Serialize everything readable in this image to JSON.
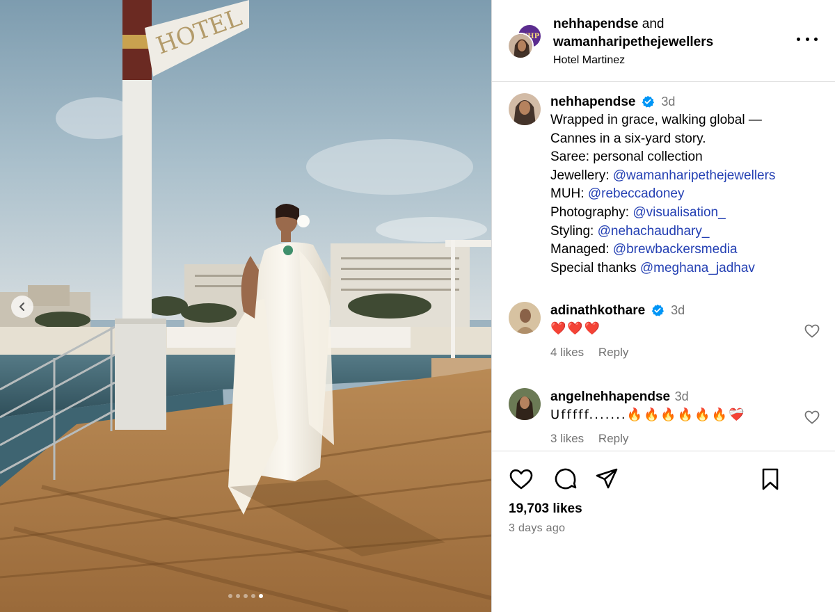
{
  "photo": {
    "sign_text": "HOTEL",
    "carousel_dots": 5,
    "active_dot": 5
  },
  "header": {
    "author": "nehhapendse",
    "and_text": " and",
    "collaborator": "wamanharipethejewellers",
    "location": "Hotel Martinez",
    "logo_text": "WHP"
  },
  "caption": {
    "username": "nehhapendse",
    "time": "3d",
    "lines": [
      {
        "text": "Wrapped in grace, walking global —",
        "mention": ""
      },
      {
        "text": "Cannes in a six-yard story.",
        "mention": ""
      },
      {
        "text": "Saree: personal collection",
        "mention": ""
      },
      {
        "text": "Jewellery: ",
        "mention": "@wamanharipethejewellers"
      },
      {
        "text": "MUH: ",
        "mention": "@rebeccadoney"
      },
      {
        "text": "Photography: ",
        "mention": "@visualisation_"
      },
      {
        "text": "Styling: ",
        "mention": "@nehachaudhary_"
      },
      {
        "text": "Managed: ",
        "mention": "@brewbackersmedia"
      },
      {
        "text": "Special thanks ",
        "mention": "@meghana_jadhav"
      }
    ]
  },
  "comments": [
    {
      "username": "adinathkothare",
      "time": "3d",
      "text": "❤️❤️❤️",
      "likes": "4 likes",
      "reply": "Reply"
    },
    {
      "username": "angelnehhapendse",
      "time": "3d",
      "text": "Ufffff.......🔥🔥🔥🔥🔥🔥❤️‍🩹",
      "likes": "3 likes",
      "reply": "Reply"
    }
  ],
  "footer": {
    "likes": "19,703 likes",
    "posted": "3 days ago"
  },
  "colors": {
    "mention": "#2440b3",
    "muted": "#737373",
    "verified": "#0095f6",
    "divider": "#dbdbdb"
  }
}
